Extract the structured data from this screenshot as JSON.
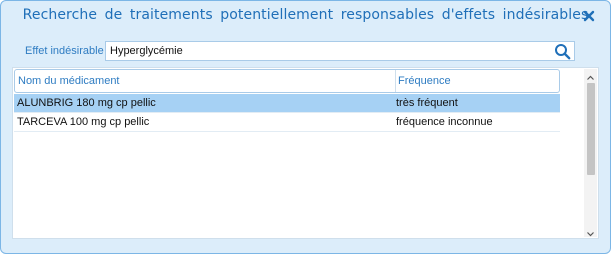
{
  "dialog": {
    "title": "Recherche de traitements potentiellement responsables d'effets indésirables",
    "close_icon": "close-icon"
  },
  "search": {
    "label": "Effet indésirable",
    "value": "Hyperglycémie",
    "icon": "search-icon"
  },
  "table": {
    "columns": [
      "Nom du médicament",
      "Fréquence"
    ],
    "rows": [
      {
        "name": "ALUNBRIG 180 mg cp pellic",
        "frequency": "très fréquent",
        "selected": true
      },
      {
        "name": "TARCEVA 100 mg cp pellic",
        "frequency": "fréquence inconnue",
        "selected": false
      }
    ]
  },
  "colors": {
    "title": "#1f6fb8",
    "accent": "#2e7cc2",
    "selection": "#a6d1f4",
    "background": "#dcedfa"
  }
}
